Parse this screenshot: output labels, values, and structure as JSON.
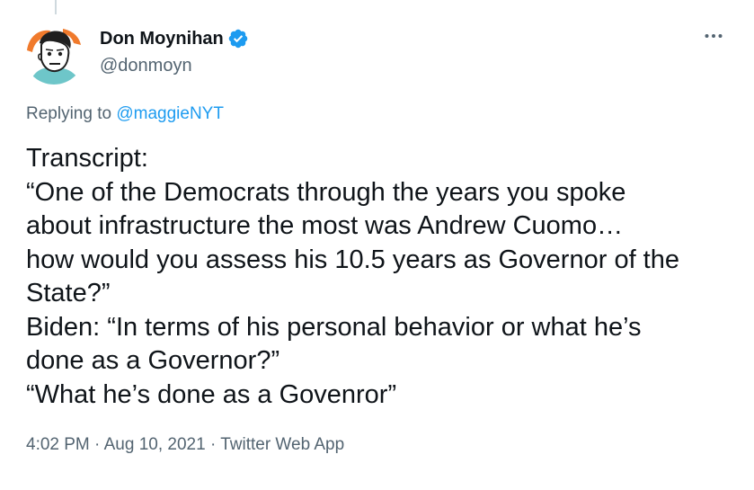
{
  "author": {
    "display_name": "Don Moynihan",
    "handle": "@donmoyn",
    "verified": true,
    "avatar_icon": "cartoon-face-avatar"
  },
  "reply_context": {
    "prefix": "Replying to",
    "mention": "@maggieNYT"
  },
  "tweet_text_lines": [
    "Transcript:",
    "“One of the Democrats through the years you spoke",
    "about infrastructure the most was Andrew Cuomo…",
    "how would you assess his 10.5 years as Governor of the",
    "State?”",
    "Biden: “In terms of his personal behavior or what he’s",
    "done as a Governor?”",
    "“What he’s done as a Govenror”"
  ],
  "meta": {
    "time": "4:02 PM",
    "separator": "·",
    "date": "Aug 10, 2021",
    "source": "Twitter Web App"
  },
  "icons": {
    "more": "more-horizontal-icon",
    "verified": "verified-badge-icon"
  },
  "colors": {
    "accent": "#1d9bf0",
    "secondary_text": "#536471",
    "primary_text": "#0f1419"
  }
}
